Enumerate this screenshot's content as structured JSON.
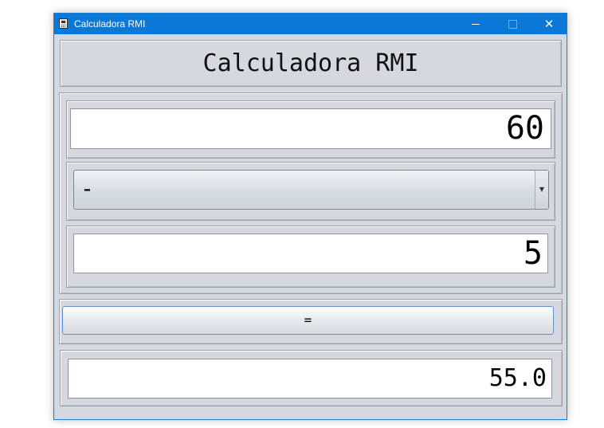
{
  "window": {
    "title": "Calculadora RMI",
    "controls": {
      "minimize": "minimize-icon",
      "maximize": "maximize-icon",
      "close": "close-icon"
    }
  },
  "header": {
    "title": "Calculadora RMI"
  },
  "operand1": {
    "value": "60"
  },
  "operator": {
    "selected": "-"
  },
  "operand2": {
    "value": "5"
  },
  "equals_button": {
    "label": "="
  },
  "result": {
    "value": "55.0"
  },
  "colors": {
    "titlebar": "#0a78d7",
    "panel": "#d5d8de",
    "field": "#ffffff",
    "button_border": "#5d92c9"
  }
}
